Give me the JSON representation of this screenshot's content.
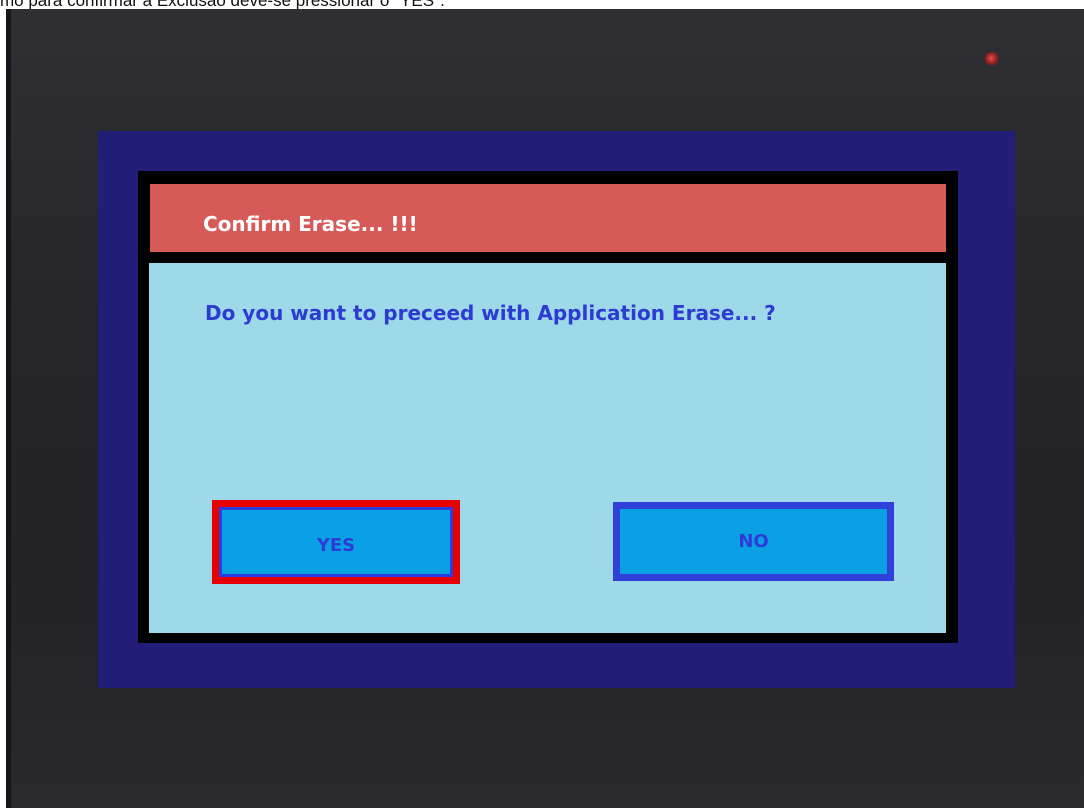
{
  "caption": "mo para confirmar a Exclusão deve-se pressionar o \"YES\".",
  "dialog": {
    "title": "Confirm Erase... !!!",
    "message": "Do you want to preceed with Application Erase... ?",
    "yes_label": "YES",
    "no_label": "NO"
  },
  "colors": {
    "bezel": "#26262a",
    "screen_background": "#221e78",
    "header": "#d65a57",
    "body": "#9ed9ea",
    "message_text": "#2d3bd1",
    "button_fill": "#0aa0e4",
    "highlight_border": "#e60000",
    "button_border": "#3040d8",
    "led": "#c03030"
  },
  "icons": {
    "power_led": "status-led"
  }
}
